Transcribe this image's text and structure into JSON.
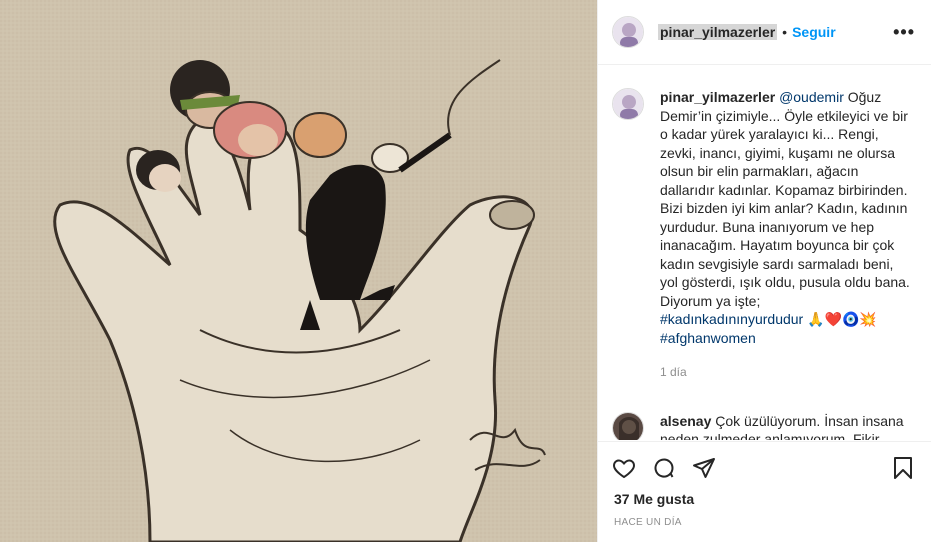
{
  "post": {
    "author": "pinar_yilmazerler",
    "dot": "•",
    "follow_label": "Seguir",
    "more_label": "•••"
  },
  "caption": {
    "user": "pinar_yilmazerler",
    "mention": "@oudemir",
    "text": " Oğuz Demir’in çizimiyle... Öyle etkileyici ve bir o kadar yürek yaralayıcı ki... Rengi, zevki, inancı, giyimi, kuşamı ne olursa olsun bir elin parmakları, ağacın dallarıdır kadınlar. Kopamaz birbirinden. Bizi bizden iyi kim anlar? Kadın, kadının yurdudur. Buna inanıyorum ve hep inanacağım. Hayatım boyunca bir çok kadın sevgisiyle sardı sarmaladı beni, yol gösterdi, ışık oldu, pusula oldu bana. Diyorum ya işte;",
    "hashtag1": "#kadınkadınınyurdudur",
    "emojis": "🙏❤️🧿💥",
    "hashtag2": "#afghanwomen",
    "time": "1 día"
  },
  "comment": {
    "user": "alsenay",
    "text": " Çok üzülüyorum. İnsan insana neden zulmeder anlamıyorum. Fikir"
  },
  "footer": {
    "likes": "37 Me gusta",
    "ago": "HACE UN DÍA"
  },
  "icons": [
    "heart-icon",
    "comment-icon",
    "share-icon",
    "bookmark-icon"
  ],
  "colors": {
    "accent": "#0095f6",
    "link": "#00376b",
    "muted": "#8e8e8e",
    "artwork_bg": "#cfc3ad"
  }
}
